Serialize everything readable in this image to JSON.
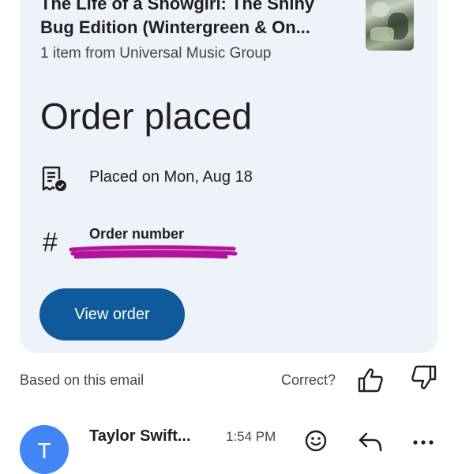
{
  "product": {
    "title": "The Life of a Showgirl: The Shiny\nBug Edition (Wintergreen & On...",
    "subtitle": "1 item from Universal Music Group",
    "thumbnail_icon": "album-cover-image"
  },
  "order": {
    "heading": "Order placed",
    "placed_icon": "receipt-check-icon",
    "placed_text": "Placed on Mon, Aug 18",
    "number_icon": "hash-icon",
    "number_label": "Order number",
    "view_button": "View order",
    "button_color": "#0e5a9a"
  },
  "feedback": {
    "based_text": "Based on this email",
    "correct_text": "Correct?",
    "thumbs_up_icon": "thumbs-up-icon",
    "thumbs_down_icon": "thumbs-down-icon"
  },
  "message": {
    "avatar_letter": "T",
    "avatar_color": "#4285f4",
    "sender": "Taylor Swift...",
    "time": "1:54 PM",
    "emoji_icon": "emoji-icon",
    "reply_icon": "reply-icon",
    "more_icon": "more-icon"
  }
}
